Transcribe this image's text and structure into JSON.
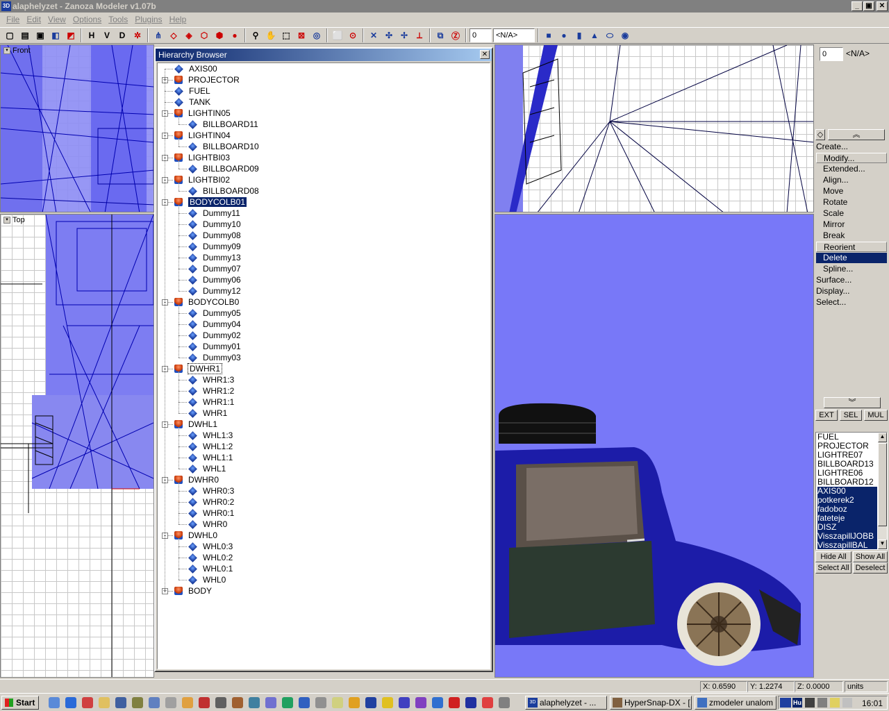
{
  "window": {
    "title": "alaphelyzet - Zanoza Modeler v1.07b",
    "min": "_",
    "max": "▣",
    "close": "✕"
  },
  "menu": [
    "File",
    "Edit",
    "View",
    "Options",
    "Tools",
    "Plugins",
    "Help"
  ],
  "toolbar": {
    "h": "H",
    "v": "V",
    "d": "D",
    "combo_value": "0",
    "combo_label": "<N/A>"
  },
  "viewports": {
    "front": "Front",
    "top": "Top"
  },
  "hierarchy": {
    "title": "Hierarchy Browser",
    "close": "✕",
    "items": [
      {
        "label": "AXIS00",
        "icon": "obj",
        "level": 0,
        "exp": ""
      },
      {
        "label": "PROJECTOR",
        "icon": "grp",
        "level": 0,
        "exp": "+"
      },
      {
        "label": "FUEL",
        "icon": "obj",
        "level": 0,
        "exp": ""
      },
      {
        "label": "TANK",
        "icon": "obj",
        "level": 0,
        "exp": ""
      },
      {
        "label": "LIGHTIN05",
        "icon": "grp",
        "level": 0,
        "exp": "-"
      },
      {
        "label": "BILLBOARD11",
        "icon": "obj",
        "level": 1,
        "exp": ""
      },
      {
        "label": "LIGHTIN04",
        "icon": "grp",
        "level": 0,
        "exp": "-"
      },
      {
        "label": "BILLBOARD10",
        "icon": "obj",
        "level": 1,
        "exp": ""
      },
      {
        "label": "LIGHTBI03",
        "icon": "grp",
        "level": 0,
        "exp": "-"
      },
      {
        "label": "BILLBOARD09",
        "icon": "obj",
        "level": 1,
        "exp": ""
      },
      {
        "label": "LIGHTBI02",
        "icon": "grp",
        "level": 0,
        "exp": "-"
      },
      {
        "label": "BILLBOARD08",
        "icon": "obj",
        "level": 1,
        "exp": ""
      },
      {
        "label": "BODYCOLB01",
        "icon": "grp",
        "level": 0,
        "exp": "-",
        "state": "sel"
      },
      {
        "label": "Dummy11",
        "icon": "obj",
        "level": 1,
        "exp": ""
      },
      {
        "label": "Dummy10",
        "icon": "obj",
        "level": 1,
        "exp": ""
      },
      {
        "label": "Dummy08",
        "icon": "obj",
        "level": 1,
        "exp": ""
      },
      {
        "label": "Dummy09",
        "icon": "obj",
        "level": 1,
        "exp": ""
      },
      {
        "label": "Dummy13",
        "icon": "obj",
        "level": 1,
        "exp": ""
      },
      {
        "label": "Dummy07",
        "icon": "obj",
        "level": 1,
        "exp": ""
      },
      {
        "label": "Dummy06",
        "icon": "obj",
        "level": 1,
        "exp": ""
      },
      {
        "label": "Dummy12",
        "icon": "obj",
        "level": 1,
        "exp": ""
      },
      {
        "label": "BODYCOLB0",
        "icon": "grp",
        "level": 0,
        "exp": "-"
      },
      {
        "label": "Dummy05",
        "icon": "obj",
        "level": 1,
        "exp": ""
      },
      {
        "label": "Dummy04",
        "icon": "obj",
        "level": 1,
        "exp": ""
      },
      {
        "label": "Dummy02",
        "icon": "obj",
        "level": 1,
        "exp": ""
      },
      {
        "label": "Dummy01",
        "icon": "obj",
        "level": 1,
        "exp": ""
      },
      {
        "label": "Dummy03",
        "icon": "obj",
        "level": 1,
        "exp": ""
      },
      {
        "label": "DWHR1",
        "icon": "grp",
        "level": 0,
        "exp": "-",
        "state": "focus"
      },
      {
        "label": "WHR1:3",
        "icon": "obj",
        "level": 1,
        "exp": ""
      },
      {
        "label": "WHR1:2",
        "icon": "obj",
        "level": 1,
        "exp": ""
      },
      {
        "label": "WHR1:1",
        "icon": "obj",
        "level": 1,
        "exp": ""
      },
      {
        "label": "WHR1",
        "icon": "obj",
        "level": 1,
        "exp": ""
      },
      {
        "label": "DWHL1",
        "icon": "grp",
        "level": 0,
        "exp": "-"
      },
      {
        "label": "WHL1:3",
        "icon": "obj",
        "level": 1,
        "exp": ""
      },
      {
        "label": "WHL1:2",
        "icon": "obj",
        "level": 1,
        "exp": ""
      },
      {
        "label": "WHL1:1",
        "icon": "obj",
        "level": 1,
        "exp": ""
      },
      {
        "label": "WHL1",
        "icon": "obj",
        "level": 1,
        "exp": ""
      },
      {
        "label": "DWHR0",
        "icon": "grp",
        "level": 0,
        "exp": "-"
      },
      {
        "label": "WHR0:3",
        "icon": "obj",
        "level": 1,
        "exp": ""
      },
      {
        "label": "WHR0:2",
        "icon": "obj",
        "level": 1,
        "exp": ""
      },
      {
        "label": "WHR0:1",
        "icon": "obj",
        "level": 1,
        "exp": ""
      },
      {
        "label": "WHR0",
        "icon": "obj",
        "level": 1,
        "exp": ""
      },
      {
        "label": "DWHL0",
        "icon": "grp",
        "level": 0,
        "exp": "-"
      },
      {
        "label": "WHL0:3",
        "icon": "obj",
        "level": 1,
        "exp": ""
      },
      {
        "label": "WHL0:2",
        "icon": "obj",
        "level": 1,
        "exp": ""
      },
      {
        "label": "WHL0:1",
        "icon": "obj",
        "level": 1,
        "exp": ""
      },
      {
        "label": "WHL0",
        "icon": "obj",
        "level": 1,
        "exp": ""
      },
      {
        "label": "BODY",
        "icon": "grp",
        "level": 0,
        "exp": "+"
      }
    ]
  },
  "right_panel": {
    "combo_value": "0",
    "combo_label": "<N/A>",
    "commands": [
      {
        "label": "Create...",
        "sub": false
      },
      {
        "label": "Modify...",
        "sub": false,
        "state": "box"
      },
      {
        "label": "Extended...",
        "sub": true
      },
      {
        "label": "Align...",
        "sub": true
      },
      {
        "label": "Move",
        "sub": true
      },
      {
        "label": "Rotate",
        "sub": true
      },
      {
        "label": "Scale",
        "sub": true
      },
      {
        "label": "Mirror",
        "sub": true
      },
      {
        "label": "Break",
        "sub": true
      },
      {
        "label": "Reorient",
        "sub": true,
        "state": "box"
      },
      {
        "label": "Delete",
        "sub": true,
        "state": "hl"
      },
      {
        "label": "Spline...",
        "sub": true
      },
      {
        "label": "Surface...",
        "sub": false
      },
      {
        "label": "Display...",
        "sub": false
      },
      {
        "label": "Select...",
        "sub": false
      }
    ],
    "mode_buttons": [
      "EXT",
      "SEL",
      "MUL"
    ],
    "object_list": [
      {
        "label": "FUEL",
        "s": false
      },
      {
        "label": "PROJECTOR",
        "s": false
      },
      {
        "label": "LIGHTRE07",
        "s": false
      },
      {
        "label": "BILLBOARD13",
        "s": false
      },
      {
        "label": "LIGHTRE06",
        "s": false
      },
      {
        "label": "BILLBOARD12",
        "s": false
      },
      {
        "label": "AXIS00",
        "s": true
      },
      {
        "label": "potkerek2",
        "s": true
      },
      {
        "label": "fadoboz",
        "s": true
      },
      {
        "label": "fateteje",
        "s": true
      },
      {
        "label": "DISZ",
        "s": true
      },
      {
        "label": "VisszapillJOBB",
        "s": true
      },
      {
        "label": "VisszapillBAL",
        "s": true
      }
    ],
    "hide_all": "Hide All",
    "show_all": "Show All",
    "select_all": "Select All",
    "deselect": "Deselect"
  },
  "status": {
    "x": "X: 0.6590",
    "y": "Y: 1.2274",
    "z": "Z: 0.0000",
    "units": "units"
  },
  "taskbar": {
    "start": "Start",
    "tasks": [
      {
        "label": "alaphelyzet - ...",
        "active": true
      },
      {
        "label": "HyperSnap-DX - [...",
        "active": false
      },
      {
        "label": "zmodeler unalom ...",
        "active": false
      }
    ],
    "clock": "16:01"
  },
  "colors": {
    "accent": "#0a246a",
    "viewport_blue": "#8080f8",
    "mesh": "#0000c8"
  }
}
